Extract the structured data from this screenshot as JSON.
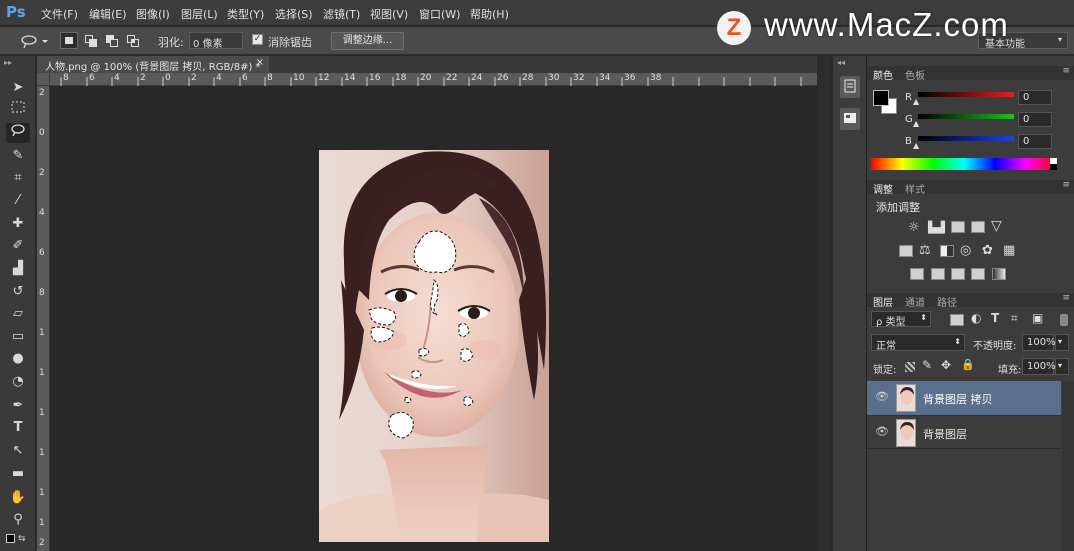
{
  "app": {
    "logo": "Ps",
    "menu": [
      "文件(F)",
      "编辑(E)",
      "图像(I)",
      "图层(L)",
      "类型(Y)",
      "选择(S)",
      "滤镜(T)",
      "视图(V)",
      "窗口(W)",
      "帮助(H)"
    ]
  },
  "watermark": {
    "badge": "Z",
    "text": "www.MacZ.com"
  },
  "options": {
    "feather_label": "羽化:",
    "feather_value": "0 像素",
    "antialias_label": "消除锯齿",
    "antialias_checked": true,
    "refine_edge_label": "调整边缘...",
    "workspace": "基本功能"
  },
  "document": {
    "tab_title": "人物.png @ 100% (背景图层 拷贝, RGB/8#) *",
    "close": "×",
    "hruler_labels": [
      "8",
      "6",
      "4",
      "2",
      "0",
      "2",
      "4",
      "6",
      "8",
      "10",
      "12",
      "14",
      "16",
      "18",
      "20",
      "22",
      "24",
      "26",
      "28",
      "30",
      "32",
      "34",
      "36",
      "38"
    ],
    "vruler_labels": [
      "2",
      "0",
      "2",
      "4",
      "6",
      "8",
      "1",
      "1",
      "1",
      "1",
      "1",
      "1",
      "2"
    ]
  },
  "color_panel": {
    "tabs": [
      "颜色",
      "色板"
    ],
    "channels": [
      {
        "label": "R",
        "value": "0",
        "color": "#e02020"
      },
      {
        "label": "G",
        "value": "0",
        "color": "#20c020"
      },
      {
        "label": "B",
        "value": "0",
        "color": "#2040e0"
      }
    ],
    "foreground": "#000000",
    "background": "#ffffff"
  },
  "adjust_panel": {
    "tabs": [
      "调整",
      "样式"
    ],
    "heading": "添加调整"
  },
  "layers_panel": {
    "tabs": [
      "图层",
      "通道",
      "路径"
    ],
    "filter_label": "ρ 类型",
    "blend_mode": "正常",
    "opacity_label": "不透明度:",
    "opacity_value": "100%",
    "lock_label": "锁定:",
    "fill_label": "填充:",
    "fill_value": "100%",
    "layers": [
      {
        "name": "背景图层 拷贝",
        "selected": true
      },
      {
        "name": "背景图层",
        "selected": false
      }
    ]
  },
  "colors": {
    "accent": "#5aa6e8",
    "selected_layer": "#5a6f8c",
    "watermark_orange": "#e8541d"
  }
}
